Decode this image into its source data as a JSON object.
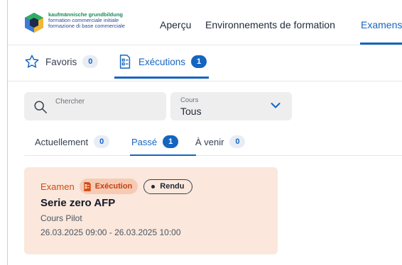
{
  "header": {
    "logo_lines": [
      "kaufmännische grundbildung",
      "formation commerciale initiale",
      "formazione di base commerciale"
    ],
    "nav": [
      "Aperçu",
      "Environnements de formation",
      "Examens"
    ]
  },
  "subtabs": [
    {
      "label": "Favoris",
      "count": "0"
    },
    {
      "label": "Exécutions",
      "count": "1"
    }
  ],
  "filters": {
    "search_placeholder": "Chercher",
    "course_label": "Cours",
    "course_value": "Tous"
  },
  "time_tabs": [
    {
      "label": "Actuellement",
      "count": "0"
    },
    {
      "label": "Passé",
      "count": "1"
    },
    {
      "label": "À venir",
      "count": "0"
    }
  ],
  "card": {
    "kind": "Examen",
    "badge": "Exécution",
    "status": "Rendu",
    "title": "Serie zero AFP",
    "course": "Cours Pilot",
    "datetime": "26.03.2025 09:00 - 26.03.2025 10:00"
  },
  "colors": {
    "accent": "#1565c0",
    "card_bg": "#fbe7dc",
    "card_accent": "#d14a12"
  }
}
